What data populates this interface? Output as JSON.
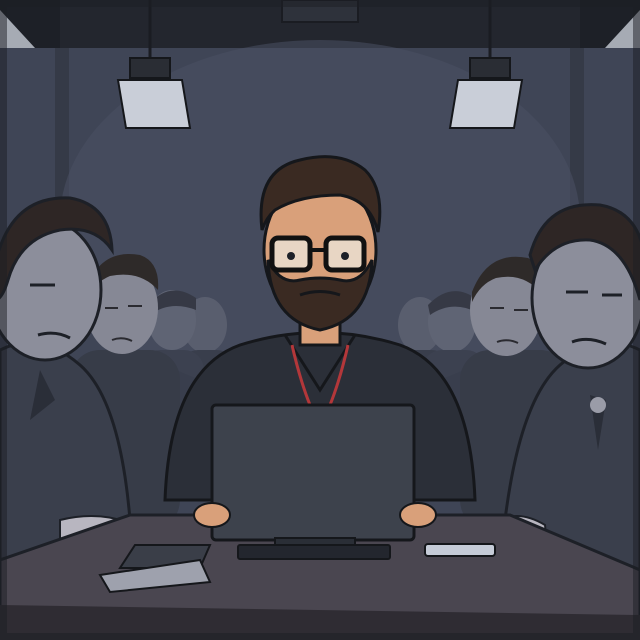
{
  "scene": {
    "setting": "dark-meeting-room",
    "colors": {
      "wall": "#3f4556",
      "wall_dark": "#2b303c",
      "ceiling": "#23262e",
      "table": "#4a4650",
      "table_edge": "#2f2c33",
      "suit": "#3a3f4c",
      "suit_dark": "#2a2e38",
      "shirt": "#2b2f38",
      "skin_main": "#d9a07a",
      "skin_grey": "#8a8c99",
      "hair": "#3a2a22",
      "laptop": "#3d424c",
      "lanyard": "#b3373a",
      "light_panel": "#c9ced8"
    },
    "icons": [
      "ceiling-light-icon",
      "laptop-icon",
      "tablet-icon",
      "phone-icon",
      "glasses-icon"
    ]
  }
}
